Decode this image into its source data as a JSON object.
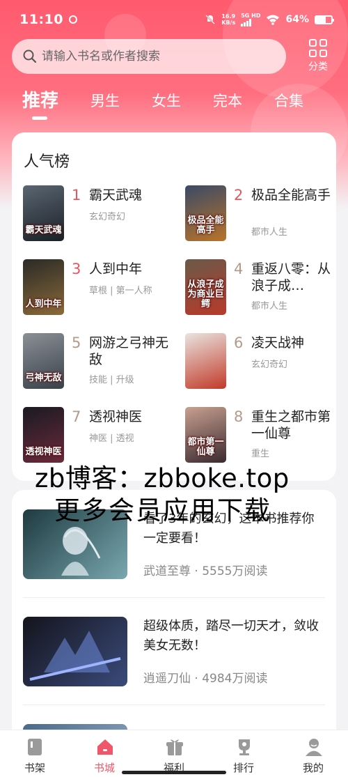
{
  "status_bar": {
    "time": "11:10",
    "net_speed_value": "16.9",
    "net_speed_unit": "KB/s",
    "sim_label": "5G HD",
    "battery": "64%",
    "battery_level": 0.64
  },
  "search": {
    "placeholder": "请输入书名或作者搜索",
    "category_label": "分类"
  },
  "tabs": [
    "推荐",
    "男生",
    "女生",
    "完本",
    "合集"
  ],
  "active_tab": "推荐",
  "ranking": {
    "title": "人气榜",
    "items": [
      {
        "rank": "1",
        "title": "霸天武魂",
        "tags": "玄幻奇幻",
        "cover_text": "霸天武魂",
        "colors": [
          "#5a6672",
          "#1a1f26"
        ]
      },
      {
        "rank": "2",
        "title": "极品全能高手",
        "tags": "都市人生",
        "cover_text": "极品全能高手",
        "colors": [
          "#3a4a66",
          "#b8742a"
        ]
      },
      {
        "rank": "3",
        "title": "人到中年",
        "tags": "草根 | 第一人称",
        "cover_text": "人到中年",
        "colors": [
          "#2a2a26",
          "#8a6a3a"
        ]
      },
      {
        "rank": "4",
        "title": "重返八零：从浪子成…",
        "tags": "都市人生",
        "cover_text": "从浪子成为商业巨鳄",
        "colors": [
          "#6a5a4a",
          "#b83a2a"
        ]
      },
      {
        "rank": "5",
        "title": "网游之弓神无敌",
        "tags": "技能 | 升级",
        "cover_text": "弓神无敌",
        "colors": [
          "#8a9096",
          "#3a4048"
        ]
      },
      {
        "rank": "6",
        "title": "凌天战神",
        "tags": "玄幻奇幻",
        "cover_text": "",
        "colors": [
          "#e8e4e0",
          "#c23a2a"
        ]
      },
      {
        "rank": "7",
        "title": "透视神医",
        "tags": "神医 | 透视",
        "cover_text": "透视神医",
        "colors": [
          "#1a1a22",
          "#6a2a3a"
        ]
      },
      {
        "rank": "8",
        "title": "重生之都市第一仙尊",
        "tags": "重生",
        "cover_text": "都市第一仙尊",
        "colors": [
          "#c8a090",
          "#3a2a30"
        ]
      }
    ]
  },
  "watermark": {
    "line1": "zb博客：zbboke.top",
    "line2": "更多会员应用下载"
  },
  "recommend_list": [
    {
      "title": "看了3年的玄幻，这本书推荐你一定要看！",
      "book": "武道至尊",
      "reads": "5555万阅读",
      "colors": [
        "#1e3a40",
        "#7aa8b0"
      ]
    },
    {
      "title": "超级体质，踏尽一切天才，敛收美女无数！",
      "book": "逍遥刀仙",
      "reads": "4984万阅读",
      "colors": [
        "#14141c",
        "#3a4a7a"
      ]
    },
    {
      "title": "",
      "book": "",
      "reads": "",
      "colors": [
        "#4a6a8a",
        "#9ab0c8"
      ]
    }
  ],
  "bottom_nav": [
    {
      "label": "书架",
      "icon": "bookshelf-icon"
    },
    {
      "label": "书城",
      "icon": "bookstore-home-icon"
    },
    {
      "label": "福利",
      "icon": "gift-icon"
    },
    {
      "label": "排行",
      "icon": "trophy-icon"
    },
    {
      "label": "我的",
      "icon": "profile-icon"
    }
  ],
  "active_nav": "书城",
  "theme": {
    "accent": "#f0566a",
    "rank_top": "#e6575f",
    "rank_other": "#b49a8b"
  }
}
